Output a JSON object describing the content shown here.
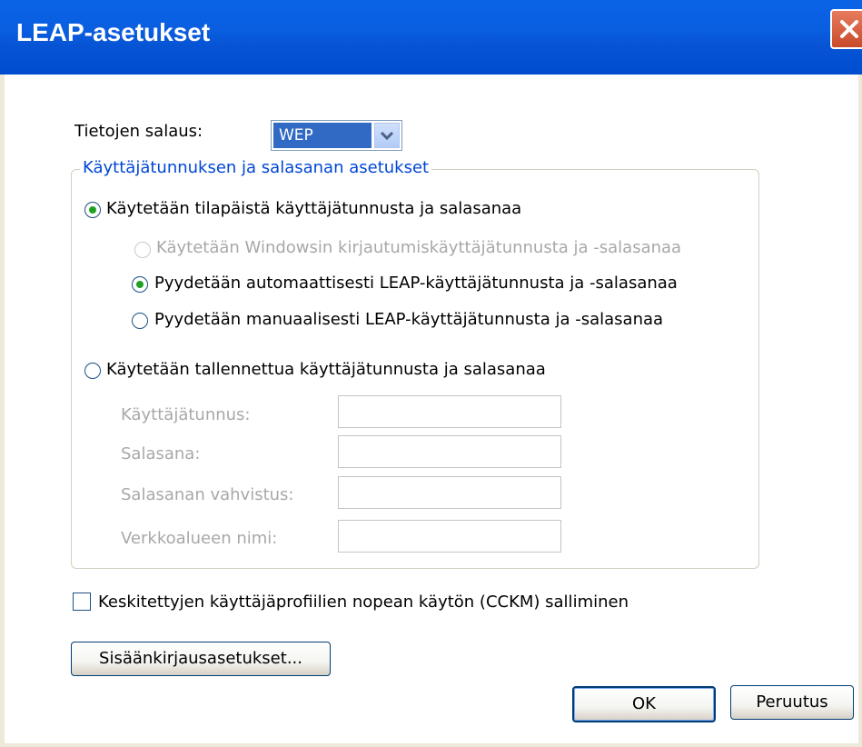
{
  "window": {
    "title": "LEAP-asetukset"
  },
  "encryption": {
    "label": "Tietojen salaus:",
    "value": "WEP"
  },
  "group": {
    "title": "Käyttäjätunnuksen ja salasanan asetukset",
    "temp_option": "Käytetään tilapäistä käyttäjätunnusta ja salasanaa",
    "windows_option": "Käytetään Windowsin kirjautumiskäyttäjätunnusta ja -salasanaa",
    "auto_option": "Pyydetään automaattisesti LEAP-käyttäjätunnusta ja -salasanaa",
    "manual_option": "Pyydetään manuaalisesti LEAP-käyttäjätunnusta ja -salasanaa",
    "saved_option": "Käytetään tallennettua käyttäjätunnusta ja salasanaa",
    "username_label": "Käyttäjätunnus:",
    "password_label": "Salasana:",
    "confirm_label": "Salasanan vahvistus:",
    "domain_label": "Verkkoalueen nimi:"
  },
  "cckm": {
    "label": "Keskitettyjen käyttäjäprofiilien nopean käytön (CCKM) salliminen",
    "checked": false
  },
  "buttons": {
    "logon": "Sisäänkirjausasetukset...",
    "ok": "OK",
    "cancel": "Peruutus"
  },
  "icons": {
    "close": "close-icon",
    "dropdown": "chevron-down-icon"
  },
  "colors": {
    "titlebar": "#0a5ee0",
    "group_title": "#0046d5",
    "radio_dot": "#21a121",
    "selection": "#316ac5"
  }
}
